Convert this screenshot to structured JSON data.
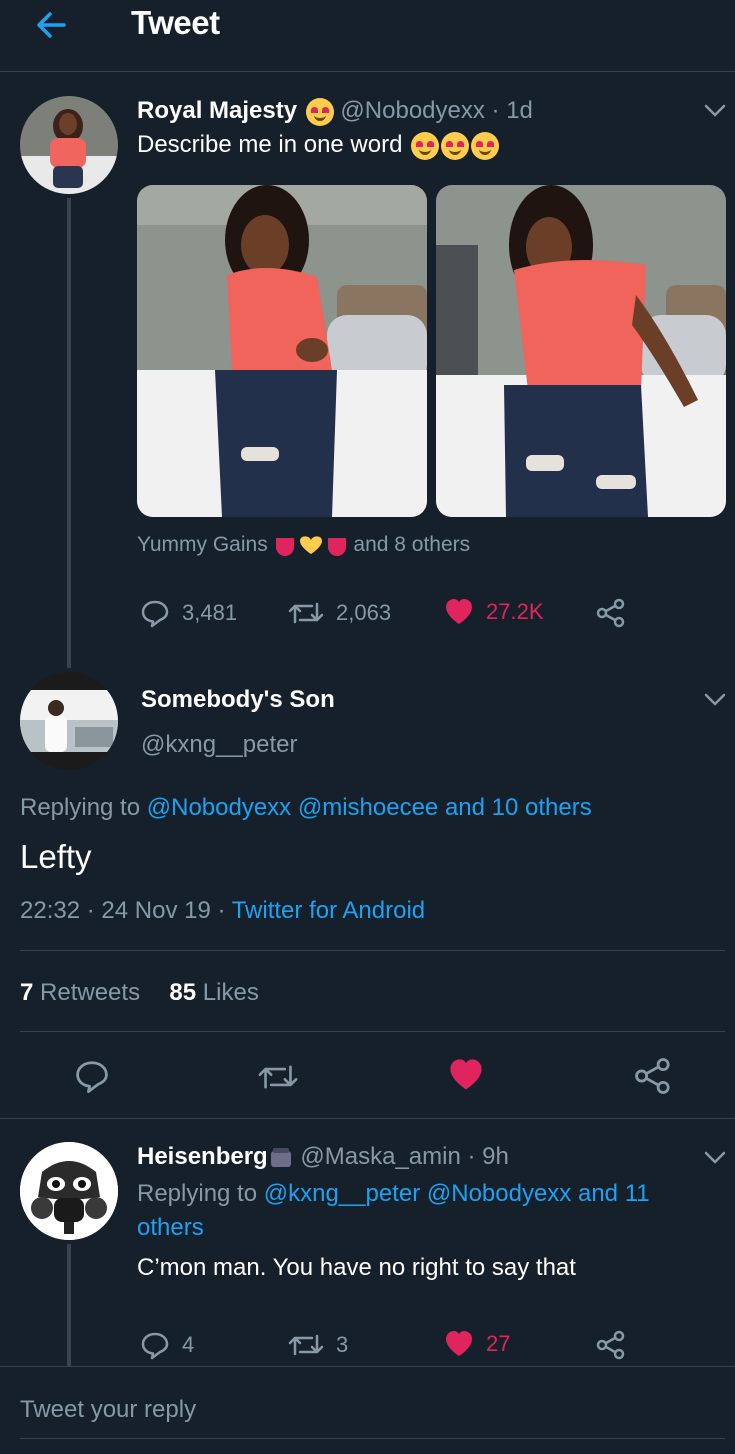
{
  "header": {
    "title": "Tweet"
  },
  "original_tweet": {
    "display_name": "Royal Majesty",
    "handle": "@Nobodyexx",
    "age": "· 1d",
    "text": "Describe me in one word",
    "liked_by": "Yummy Gains",
    "liked_by_others": "and 8 others",
    "replies": "3,481",
    "retweets": "2,063",
    "likes": "27.2K"
  },
  "main_reply": {
    "display_name": "Somebody's Son",
    "handle": "@kxng__peter",
    "replying_prefix": "Replying to",
    "replying_to": "@Nobodyexx @mishoecee and 10 others",
    "text": "Lefty",
    "time": "22:32",
    "date": "24 Nov 19",
    "source": "Twitter for Android",
    "retweet_count": "7",
    "retweet_label": "Retweets",
    "like_count": "85",
    "like_label": "Likes"
  },
  "sub_reply": {
    "display_name": "Heisenberg",
    "handle": "@Maska_amin",
    "age": "· 9h",
    "replying_prefix": "Replying to",
    "replying_line1": "@kxng__peter @Nobodyexx and 11",
    "replying_line2": "others",
    "text": "C’mon man. You have no right to say that",
    "replies": "4",
    "retweets": "3",
    "likes": "27"
  },
  "composer": {
    "placeholder": "Tweet your reply"
  },
  "colors": {
    "background": "#15202b",
    "accent": "#1da1f2",
    "like": "#e0245e",
    "muted": "#8899a6",
    "border": "#38444d"
  }
}
